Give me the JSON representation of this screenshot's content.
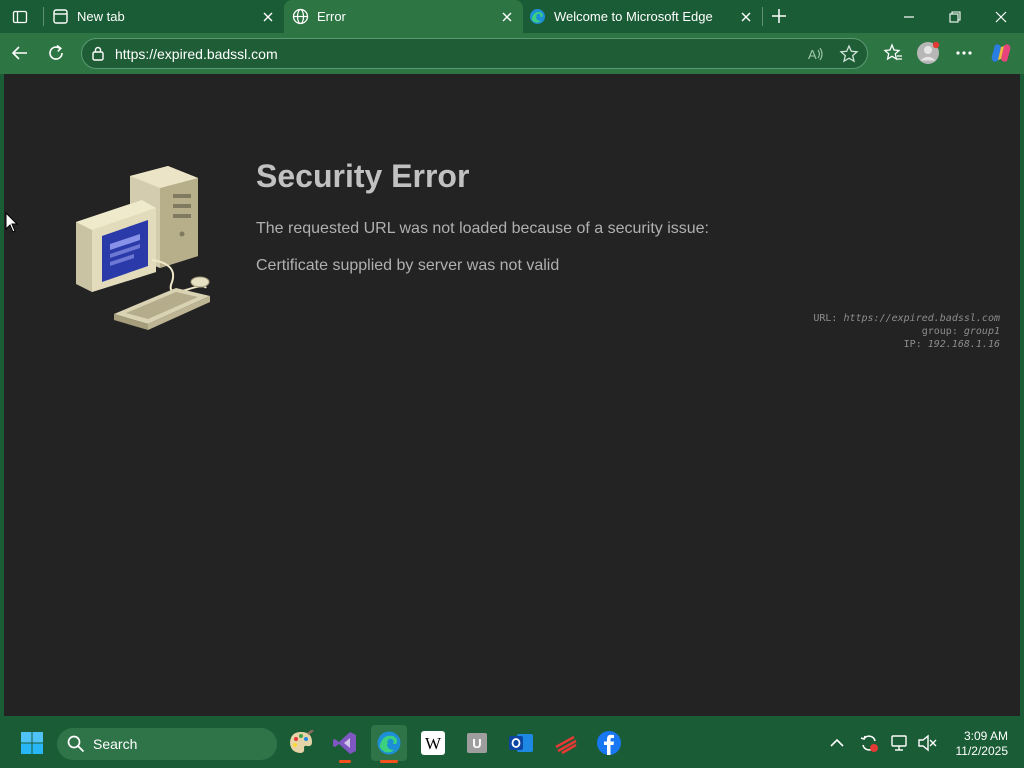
{
  "browser": {
    "tabs": [
      {
        "label": "New tab",
        "favicon": "page-icon",
        "active": false
      },
      {
        "label": "Error",
        "favicon": "globe-icon",
        "active": true
      },
      {
        "label": "Welcome to Microsoft Edge",
        "favicon": "edge-icon",
        "active": false
      }
    ],
    "address": "https://expired.badssl.com"
  },
  "page": {
    "title": "Security Error",
    "message": "The requested URL was not loaded because of a security issue:",
    "detail": "Certificate supplied by server was not valid",
    "meta": {
      "url_label": "URL:",
      "url_value": "https://expired.badssl.com",
      "group_label": "group:",
      "group_value": "group1",
      "ip_label": "IP:",
      "ip_value": "192.168.1.16"
    }
  },
  "taskbar": {
    "search_label": "Search",
    "time": "3:09 AM",
    "date": "11/2/2025"
  },
  "colors": {
    "frame": "#1a5c35",
    "toolbar": "#2e7544",
    "page_bg": "#232323",
    "title": "#c1c1c1",
    "text": "#b0b0b0"
  }
}
